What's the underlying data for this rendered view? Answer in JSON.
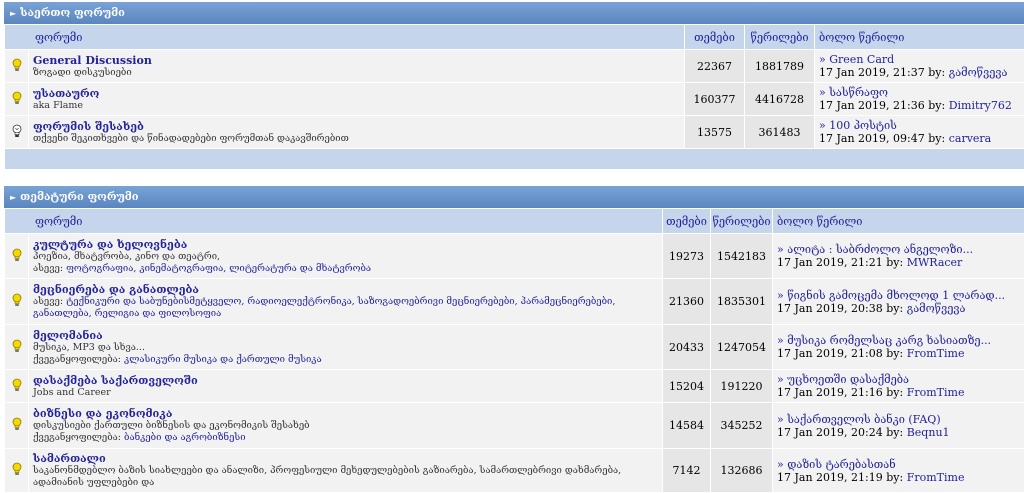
{
  "general": {
    "title": "საერთო ფორუმი",
    "columns": {
      "forum": "ფორუმი",
      "topics": "თემები",
      "posts": "წერილები",
      "last": "ბოლო წერილი"
    },
    "rows": [
      {
        "name": "General Discussion",
        "desc": "ზოგადი დისკუსიები",
        "topics": "22367",
        "posts": "1881789",
        "last_title": "Green Card",
        "last_date": "17 Jan 2019, 21:37 by:",
        "last_user": "გამოწვევა",
        "icon": "lightbulb-on-icon"
      },
      {
        "name": "უსათაურო",
        "desc": "aka Flame",
        "topics": "160377",
        "posts": "4416728",
        "last_title": "სასწრაფო",
        "last_date": "17 Jan 2019, 21:36 by:",
        "last_user": "Dimitry762",
        "icon": "lightbulb-on-icon"
      },
      {
        "name": "ფორუმის შესახებ",
        "desc": "თქვენი შეკითხვები და წინადადებები ფორუმთან დაკავშირებით",
        "topics": "13575",
        "posts": "361483",
        "last_title": "100 პოსტის",
        "last_date": "17 Jan 2019, 09:47 by:",
        "last_user": "carvera",
        "icon": "lightbulb-off-icon"
      }
    ]
  },
  "thematic": {
    "title": "თემატური ფორუმი",
    "columns": {
      "forum": "ფორუმი",
      "topics": "თემები",
      "posts": "წერილები",
      "last": "ბოლო წერილი"
    },
    "rows": [
      {
        "name": "კულტურა და ხელოვნება",
        "desc": "პოეზია, მხატვრობა, კინო და თეატრი,",
        "sub_label": "ასევე:",
        "sub": "ფოტოგრაფია, კინემატოგრაფია, ლიტერატურა და მხატვრობა",
        "topics": "19273",
        "posts": "1542183",
        "last_title": "ალიტა : საბრძოლო ანგელოზი...",
        "last_date": "17 Jan 2019, 21:21 by:",
        "last_user": "MWRacer",
        "icon": "lightbulb-on-icon"
      },
      {
        "name": "მეცნიერება და განათლება",
        "desc": "",
        "sub_label": "ასევე:",
        "sub": "ტექნიკური და საბუნებისმეტყველო, რადიოელექტრონიკა, საზოგადოებრივი მეცნიერებები, პარამეცნიერებები, განათლება, რელიგია და ფილოსოფია",
        "topics": "21360",
        "posts": "1835301",
        "last_title": "წიგნის გამოცემა მხოლოდ 1 ლარად...",
        "last_date": "17 Jan 2019, 20:38 by:",
        "last_user": "გამოწვევა",
        "icon": "lightbulb-on-icon"
      },
      {
        "name": "მელომანია",
        "desc": "მუსიკა, MP3 და სხვა...",
        "sub_label": "ქვეგანყოფილება:",
        "sub": "კლასიკური მუსიკა და ქართული მუსიკა",
        "topics": "20433",
        "posts": "1247054",
        "last_title": "მუსიკა რომელსაც კარგ ხასიათზე...",
        "last_date": "17 Jan 2019, 21:08 by:",
        "last_user": "FromTime",
        "icon": "lightbulb-on-icon"
      },
      {
        "name": "დასაქმება საქართველოში",
        "desc": "Jobs and Career",
        "sub_label": "",
        "sub": "",
        "topics": "15204",
        "posts": "191220",
        "last_title": "უცხოეთში დასაქმება",
        "last_date": "17 Jan 2019, 21:16 by:",
        "last_user": "FromTime",
        "icon": "lightbulb-on-icon"
      },
      {
        "name": "ბიზნესი და ეკონომიკა",
        "desc": "დისკუსიები ქართული ბიზნესის და ეკონომიკის შესახებ",
        "sub_label": "ქვეგანყოფილება:",
        "sub": "ბანკები და აგრობიზნესი",
        "topics": "14584",
        "posts": "345252",
        "last_title": "საქართველოს ბანკი (FAQ)",
        "last_date": "17 Jan 2019, 20:24 by:",
        "last_user": "Beqnu1",
        "icon": "lightbulb-on-icon"
      },
      {
        "name": "სამართალი",
        "desc": "საკანონმდებლო ბაზის სიახლეები და ანალიზი, პროფესიული მეხედულებების გაზიარება, სამართლებრივი დახმარება, ადამიანის უფლებები და",
        "sub_label": "",
        "sub": "",
        "topics": "7142",
        "posts": "132686",
        "last_title": "დაზის ტარებასთან",
        "last_date": "17 Jan 2019, 21:19 by:",
        "last_user": "FromTime",
        "icon": "lightbulb-on-icon"
      }
    ]
  },
  "last_post_prefix": "»"
}
